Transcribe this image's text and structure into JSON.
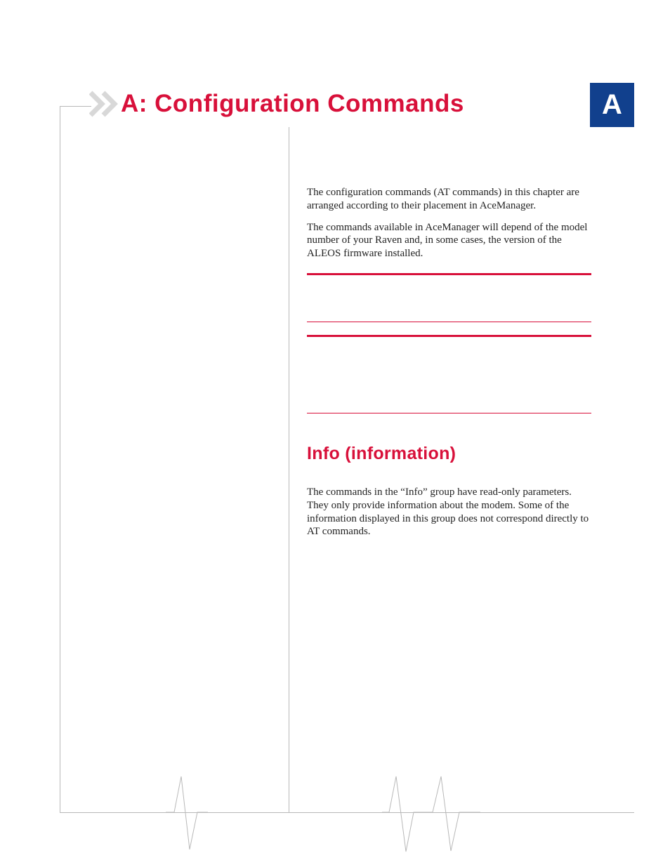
{
  "appendix": {
    "badge": "A",
    "title": "A: Configuration Commands"
  },
  "intro": {
    "p1": "The configuration commands (AT commands) in this chapter are arranged according to their placement in AceManager.",
    "p2": "The commands available in AceManager will depend of the model number of your Raven and, in some cases, the version of the ALEOS firmware installed."
  },
  "section": {
    "heading": "Info (information)",
    "p1": "The commands in the “Info” group have read-only param­eters. They only provide information about the modem. Some of the information displayed in this group does not correspond directly to AT commands."
  }
}
